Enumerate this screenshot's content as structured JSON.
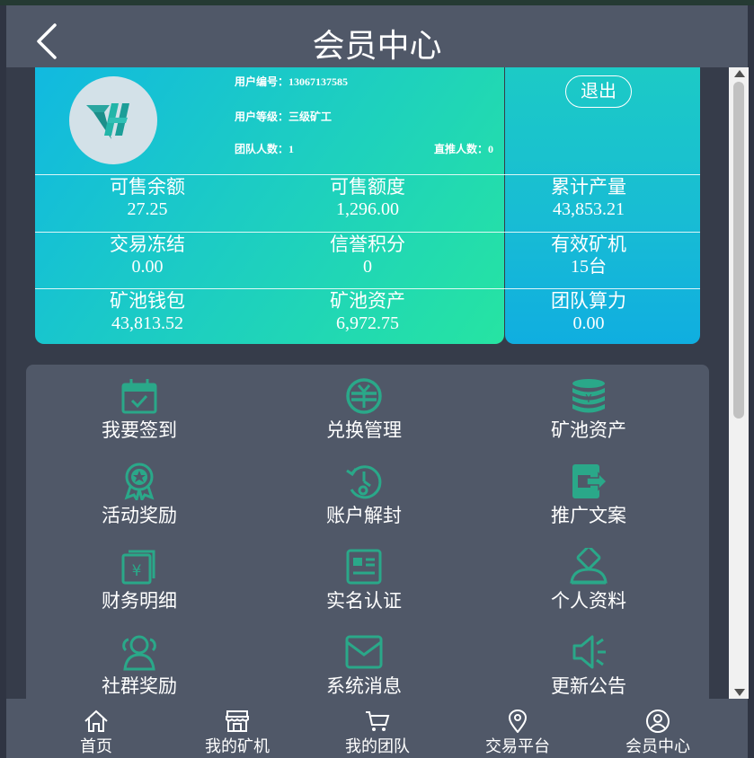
{
  "header": {
    "title": "会员中心"
  },
  "user": {
    "id_label": "用户编号：",
    "id_value": "13067137585",
    "level_label": "用户等级：",
    "level_value": "三级矿工",
    "team_label": "团队人数：",
    "team_value": "1",
    "direct_label": "直推人数：",
    "direct_value": "0",
    "logout_label": "退出"
  },
  "stats": [
    {
      "label": "可售余额",
      "value": "27.25"
    },
    {
      "label": "可售额度",
      "value": "1,296.00"
    },
    {
      "label": "累计产量",
      "value": "43,853.21"
    },
    {
      "label": "交易冻结",
      "value": "0.00"
    },
    {
      "label": "信誉积分",
      "value": "0"
    },
    {
      "label": "有效矿机",
      "value": "15台"
    },
    {
      "label": "矿池钱包",
      "value": "43,813.52"
    },
    {
      "label": "矿池资产",
      "value": "6,972.75"
    },
    {
      "label": "团队算力",
      "value": "0.00"
    }
  ],
  "menu": [
    {
      "label": "我要签到",
      "icon": "calendar-check-icon"
    },
    {
      "label": "兑换管理",
      "icon": "exchange-icon"
    },
    {
      "label": "矿池资产",
      "icon": "coin-stack-icon"
    },
    {
      "label": "活动奖励",
      "icon": "medal-icon"
    },
    {
      "label": "账户解封",
      "icon": "unlock-clock-icon"
    },
    {
      "label": "推广文案",
      "icon": "share-icon"
    },
    {
      "label": "财务明细",
      "icon": "finance-detail-icon"
    },
    {
      "label": "实名认证",
      "icon": "id-card-icon"
    },
    {
      "label": "个人资料",
      "icon": "user-profile-icon"
    },
    {
      "label": "社群奖励",
      "icon": "community-icon"
    },
    {
      "label": "系统消息",
      "icon": "mail-icon"
    },
    {
      "label": "更新公告",
      "icon": "megaphone-icon"
    }
  ],
  "tabs": [
    {
      "label": "首页",
      "icon": "home-icon"
    },
    {
      "label": "我的矿机",
      "icon": "store-icon"
    },
    {
      "label": "我的团队",
      "icon": "cart-icon"
    },
    {
      "label": "交易平台",
      "icon": "location-pin-icon"
    },
    {
      "label": "会员中心",
      "icon": "user-circle-icon"
    }
  ],
  "colors": {
    "accent": "#2aa889",
    "header_bg": "#505868",
    "page_bg": "#363c4a",
    "card_gradient_start": "#11b9e0",
    "card_gradient_end": "#26e4a2"
  }
}
